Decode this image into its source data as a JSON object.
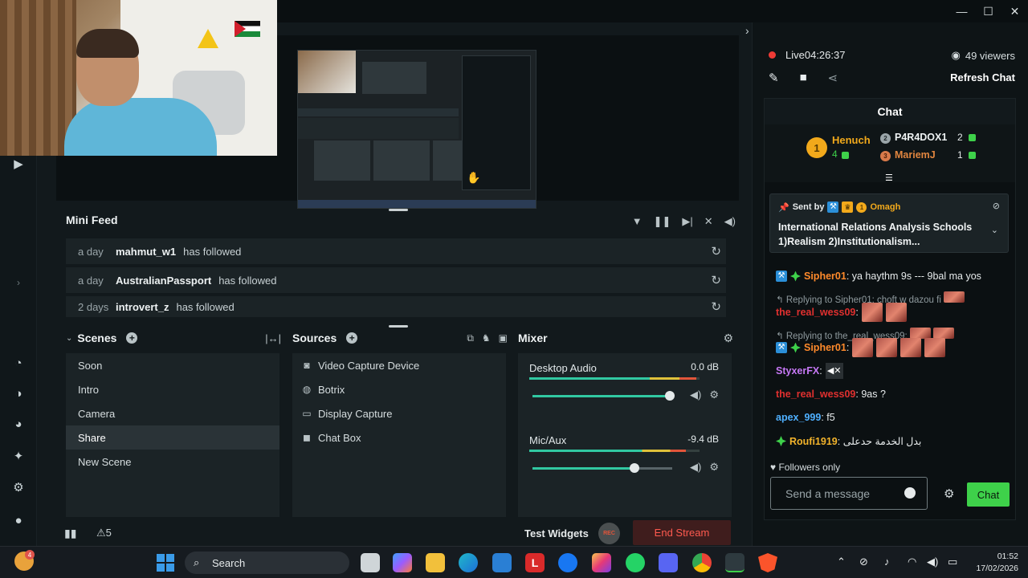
{
  "window": {
    "controls": [
      "—",
      "☐",
      "✕"
    ]
  },
  "preview": {
    "cursor": "hand-cursor-icon"
  },
  "minifeed": {
    "title": "Mini Feed",
    "items": [
      {
        "time": "a day",
        "user": "mahmut_w1",
        "action": "has followed"
      },
      {
        "time": "a day",
        "user": "AustralianPassport",
        "action": "has followed"
      },
      {
        "time": "2 days",
        "user": "introvert_z",
        "action": "has followed"
      }
    ]
  },
  "scenes": {
    "title": "Scenes",
    "items": [
      "Soon",
      "Intro",
      "Camera",
      "Share",
      "New Scene"
    ],
    "active": "Share"
  },
  "sources": {
    "title": "Sources",
    "items": [
      {
        "label": "Video Capture Device",
        "icon": "camera-icon"
      },
      {
        "label": "Botrix",
        "icon": "globe-icon"
      },
      {
        "label": "Display Capture",
        "icon": "monitor-icon"
      },
      {
        "label": "Chat Box",
        "icon": "chat-icon"
      }
    ]
  },
  "mixer": {
    "title": "Mixer",
    "channels": [
      {
        "name": "Desktop Audio",
        "db": "0.0 dB",
        "meter_level": 0.98,
        "volume": 0.98
      },
      {
        "name": "Mic/Aux",
        "db": "-9.4 dB",
        "meter_level": 0.92,
        "volume": 0.73
      }
    ]
  },
  "footer": {
    "alerts_count": "5",
    "test_widgets": "Test Widgets",
    "rec_label": "REC",
    "end_stream": "End Stream"
  },
  "chat": {
    "live_label": "Live",
    "live_time": "04:26:37",
    "viewers": "49 viewers",
    "refresh": "Refresh Chat",
    "title": "Chat",
    "leaderboard": {
      "first": {
        "rank": "1",
        "name": "Henuch",
        "count": "4"
      },
      "second": {
        "rank": "2",
        "name": "P4R4DOX1",
        "count": "2"
      },
      "third": {
        "rank": "3",
        "name": "MariemJ",
        "count": "1"
      }
    },
    "pinned": {
      "sent_by": "Sent by",
      "rank": "1",
      "user": "Omagh",
      "message": "International Relations Analysis Schools 1)Realism 2)Institutionalism..."
    },
    "messages": [
      {
        "user": "Sipher01",
        "text": ": ya haythm 9s --- 9bal ma yos",
        "color": "#ff8a2b"
      },
      {
        "reply": "Replying to Sipher01: choft w dazou fi"
      },
      {
        "user": "the_real_wess09",
        "text": ":",
        "color": "#e0302f"
      },
      {
        "reply": "Replying to the_real_wess09:"
      },
      {
        "user": "Sipher01",
        "text": ":",
        "color": "#ff8a2b"
      },
      {
        "user": "StyxerFX",
        "text": ":",
        "color": "#c678f5"
      },
      {
        "user": "the_real_wess09",
        "text": ": 9as ?",
        "color": "#e0302f"
      },
      {
        "user": "apex_999",
        "text": ": f5",
        "color": "#4fb0ff"
      },
      {
        "user": "Roufi1919",
        "text": ": بدل الخدمة حدعلى",
        "color": "#f2b32b"
      }
    ],
    "followers_only": "Followers only",
    "input_placeholder": "Send a message",
    "send_button": "Chat"
  },
  "taskbar": {
    "weather_badge": "4",
    "search_label": "Search",
    "time": "01:52",
    "date": "17/02/2026",
    "colors": {
      "start": "#3a9be8",
      "accent": "#3ed14a",
      "end_stream": "#ff5a4f"
    }
  }
}
